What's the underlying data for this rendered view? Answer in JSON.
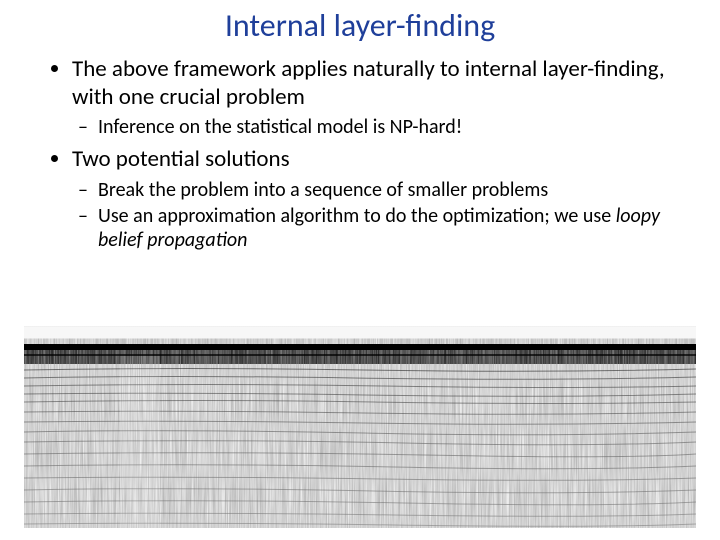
{
  "title": "Internal layer-finding",
  "bullets": {
    "b1": "The above framework applies naturally to internal layer-finding, with one crucial problem",
    "b1_1": "Inference on the statistical model is NP-hard!",
    "b2": "Two potential solutions",
    "b2_1": "Break the problem into a sequence of smaller problems",
    "b2_2a": "Use an approximation algorithm to do the optimization; we use ",
    "b2_2b": "loopy belief propagation"
  }
}
